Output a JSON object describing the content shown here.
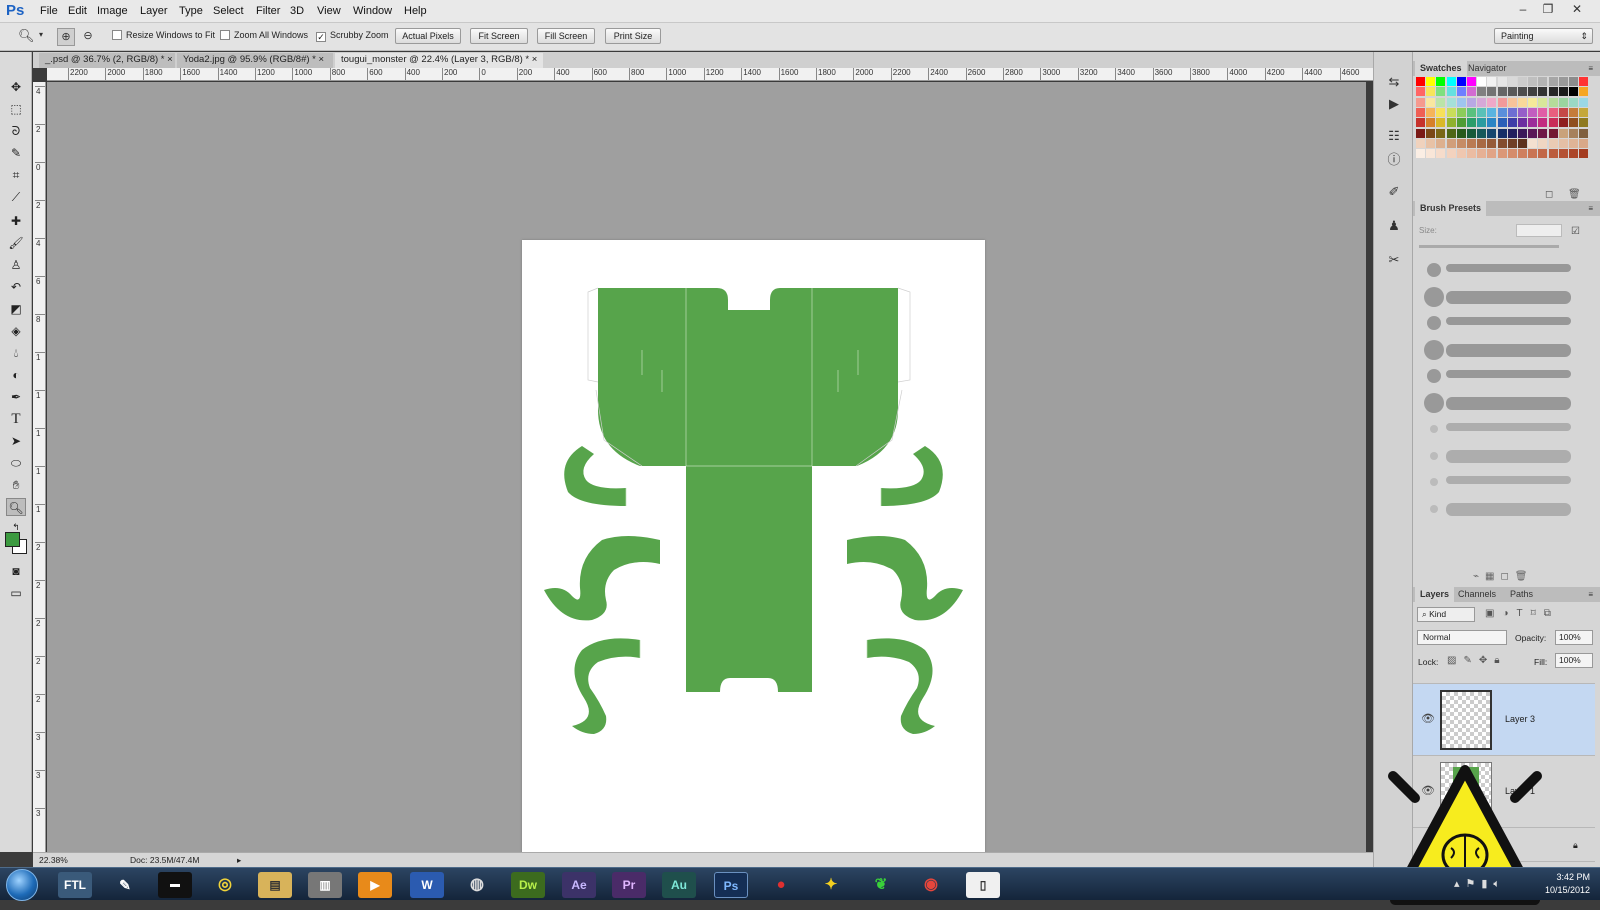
{
  "app": {
    "logo": "Ps",
    "menu": [
      "File",
      "Edit",
      "Image",
      "Layer",
      "Type",
      "Select",
      "Filter",
      "3D",
      "View",
      "Window",
      "Help"
    ],
    "window_controls": [
      "–",
      "❐",
      "✕"
    ]
  },
  "options_bar": {
    "checks": [
      {
        "label": "Resize Windows to Fit",
        "checked": false
      },
      {
        "label": "Zoom All Windows",
        "checked": false
      },
      {
        "label": "Scrubby Zoom",
        "checked": true
      }
    ],
    "buttons": [
      "Actual Pixels",
      "Fit Screen",
      "Fill Screen",
      "Print Size"
    ],
    "workspace": "Painting"
  },
  "tabs": [
    {
      "label": "_.psd @ 36.7% (2, RGB/8) *",
      "active": false
    },
    {
      "label": "Yoda2.jpg @ 95.9% (RGB/8#) *",
      "active": false
    },
    {
      "label": "tougui_monster @ 22.4% (Layer 3, RGB/8) *",
      "active": true
    }
  ],
  "ruler_h": [
    "2200",
    "2000",
    "1800",
    "1600",
    "1400",
    "1200",
    "1000",
    "800",
    "600",
    "400",
    "200",
    "0",
    "200",
    "400",
    "600",
    "800",
    "1000",
    "1200",
    "1400",
    "1600",
    "1800",
    "2000",
    "2200",
    "2400",
    "2600",
    "2800",
    "3000",
    "3200",
    "3400",
    "3600",
    "3800",
    "4000",
    "4200",
    "4400",
    "4600"
  ],
  "ruler_v": [
    "4",
    "2",
    "0",
    "2",
    "4",
    "6",
    "8",
    "1",
    "1",
    "1",
    "1",
    "1",
    "2",
    "2",
    "2",
    "2",
    "2",
    "3",
    "3",
    "3"
  ],
  "status": {
    "zoom": "22.38%",
    "doc": "Doc: 23.5M/47.4M"
  },
  "colors": {
    "artwork_green": "#57a44b",
    "foreground": "#3c9a40",
    "background": "#ffffff",
    "selection_blue": "#c4d8f2"
  },
  "panels": {
    "swatches_tabs": [
      "Swatches",
      "Navigator"
    ],
    "brush_tabs": [
      "Brush Presets"
    ],
    "brush_size_label": "Size:",
    "layers_tabs": [
      "Layers",
      "Channels",
      "Paths"
    ],
    "kind": "Kind",
    "blend_mode": "Normal",
    "opacity_label": "Opacity:",
    "opacity_value": "100%",
    "lock_label": "Lock:",
    "fill_label": "Fill:",
    "fill_value": "100%",
    "layers": [
      {
        "name": "Layer 3",
        "selected": true
      },
      {
        "name": "Layer 1",
        "selected": false
      },
      {
        "name": "",
        "selected": false
      }
    ]
  },
  "taskbar": {
    "apps": [
      "FTL",
      "Dw",
      "Ae",
      "Pr",
      "Au",
      "Ps",
      "W"
    ],
    "time": "3:42 PM",
    "date": "10/15/2012"
  }
}
